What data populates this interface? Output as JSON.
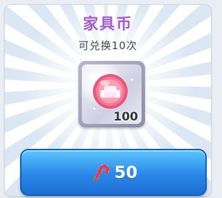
{
  "item": {
    "name": "家具币",
    "redeem_limit_text": "可兑换10次",
    "quantity": "100",
    "icon": "furniture-coin-icon"
  },
  "purchase": {
    "price": "50",
    "currency_icon": "candy-cane-icon"
  },
  "colors": {
    "title": "#a35ad0",
    "button": "#2a87e8"
  }
}
